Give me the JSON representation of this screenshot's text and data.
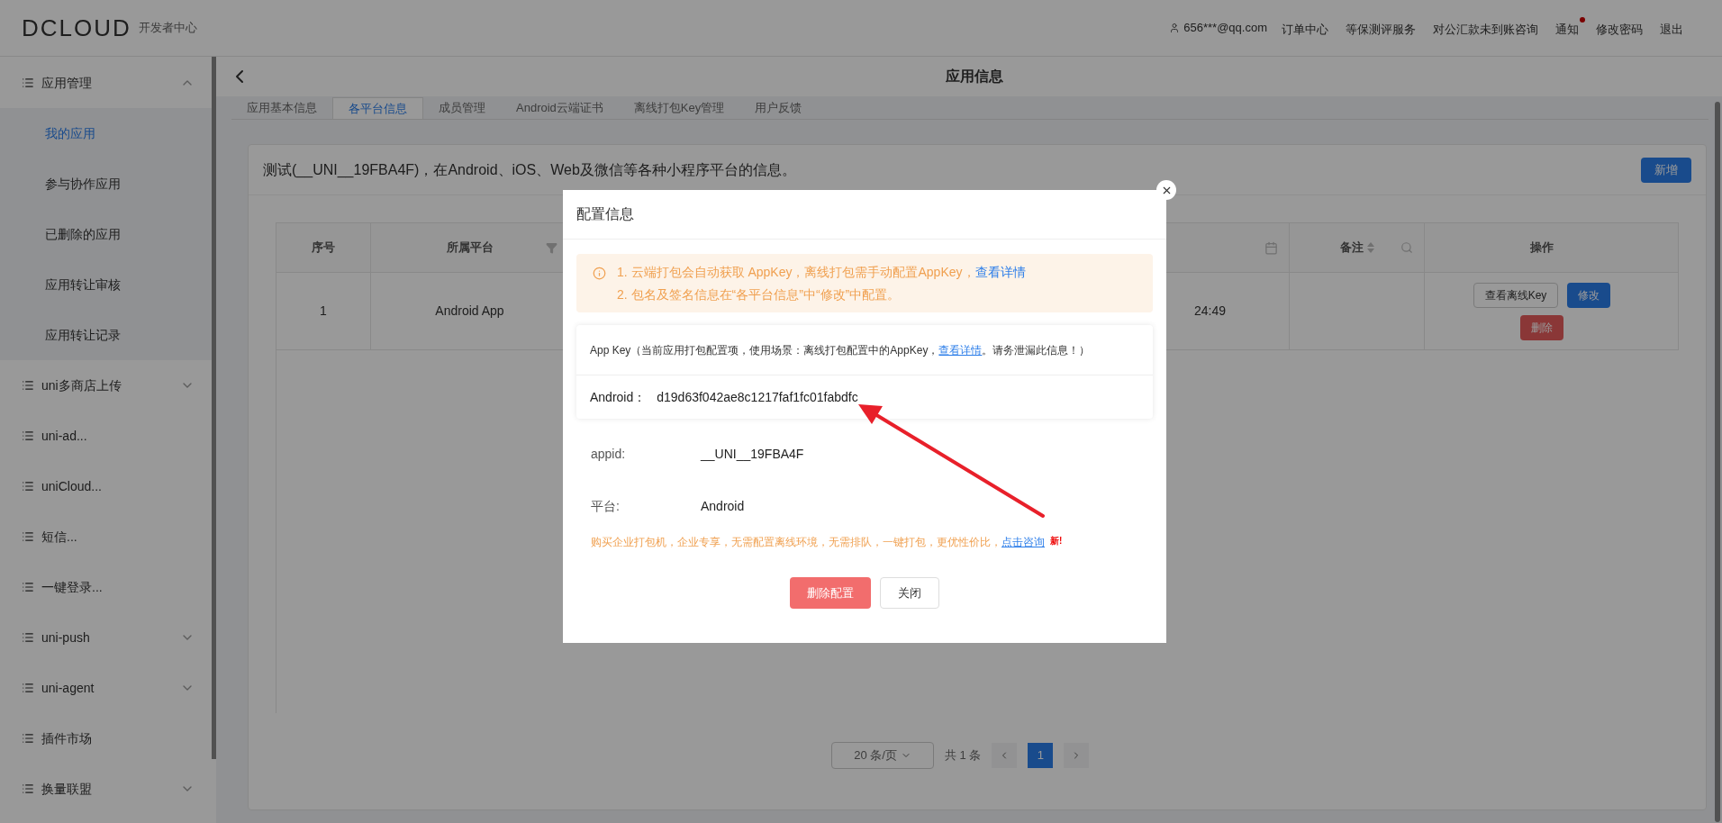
{
  "header": {
    "logo": "DCLOUD",
    "subtitle": "开发者中心",
    "user": "656***@qq.com",
    "links": [
      {
        "label": "订单中心",
        "dot": false
      },
      {
        "label": "等保测评服务",
        "dot": false
      },
      {
        "label": "对公汇款未到账咨询",
        "dot": false
      },
      {
        "label": "通知",
        "dot": true
      },
      {
        "label": "修改密码",
        "dot": false
      },
      {
        "label": "退出",
        "dot": false
      }
    ]
  },
  "sidebar": {
    "items": [
      {
        "label": "应用管理",
        "kind": "group",
        "expanded": true,
        "children": [
          {
            "label": "我的应用",
            "selected": true
          },
          {
            "label": "参与协作应用",
            "selected": false
          },
          {
            "label": "已删除的应用",
            "selected": false
          },
          {
            "label": "应用转让审核",
            "selected": false
          },
          {
            "label": "应用转让记录",
            "selected": false
          }
        ]
      },
      {
        "label": "uni多商店上传",
        "kind": "group",
        "expanded": false
      },
      {
        "label": "uni-ad...",
        "kind": "link"
      },
      {
        "label": "uniCloud...",
        "kind": "link"
      },
      {
        "label": "短信...",
        "kind": "link"
      },
      {
        "label": "一键登录...",
        "kind": "link"
      },
      {
        "label": "uni-push",
        "kind": "group",
        "expanded": false
      },
      {
        "label": "uni-agent",
        "kind": "group",
        "expanded": false
      },
      {
        "label": "插件市场",
        "kind": "link"
      },
      {
        "label": "换量联盟",
        "kind": "group",
        "expanded": false
      }
    ]
  },
  "page_title": "应用信息",
  "tabs": [
    {
      "label": "应用基本信息",
      "selected": false
    },
    {
      "label": "各平台信息",
      "selected": true
    },
    {
      "label": "成员管理",
      "selected": false
    },
    {
      "label": "Android云端证书",
      "selected": false
    },
    {
      "label": "离线打包Key管理",
      "selected": false
    },
    {
      "label": "用户反馈",
      "selected": false
    }
  ],
  "card": {
    "title": "测试(__UNI__19FBA4F)，在Android、iOS、Web及微信等各种小程序平台的信息。",
    "add_button": "新增"
  },
  "table": {
    "columns": [
      {
        "label": "序号",
        "kind": "plain"
      },
      {
        "label": "所属平台",
        "kind": "filter"
      },
      {
        "kind": "date"
      },
      {
        "label": "备注",
        "kind": "sort_search"
      },
      {
        "label": "操作",
        "kind": "actions"
      }
    ],
    "rows": [
      {
        "cells": [
          "1",
          "Android App",
          "24:49"
        ],
        "actions": [
          {
            "label": "查看离线Key",
            "kind": "default"
          },
          {
            "label": "修改",
            "kind": "primary"
          },
          {
            "label": "删除",
            "kind": "danger"
          }
        ]
      }
    ]
  },
  "pagination": {
    "page_size": "20 条/页",
    "total": "共 1 条",
    "pages": [
      {
        "label": "1",
        "selected": true
      }
    ]
  },
  "dialog": {
    "title": "配置信息",
    "notice": [
      {
        "text": "1. 云端打包会自动获取 AppKey，离线打包需手动配置AppKey，",
        "link": "查看详情"
      },
      {
        "text": "2. 包名及签名信息在“各平台信息”中“修改”中配置。"
      }
    ],
    "appkey": {
      "note": "App Key（当前应用打包配置项，使用场景：离线打包配置中的AppKey，",
      "link": "查看详情",
      "note_end": "。请务泄漏此信息！）",
      "label": "Android：",
      "value": "d19d63f042ae8c1217faf1fc01fabdfc"
    },
    "fields": [
      {
        "label": "appid:",
        "value": "__UNI__19FBA4F"
      },
      {
        "label": "平台:",
        "value": "Android"
      }
    ],
    "promo": {
      "text": "购买企业打包机，企业专享，无需配置离线环境，无需排队，一键打包，更优性价比，",
      "link": "点击咨询",
      "badge": "新!"
    },
    "buttons": [
      {
        "label": "删除配置",
        "kind": "danger"
      },
      {
        "label": "关闭",
        "kind": "default"
      }
    ]
  }
}
